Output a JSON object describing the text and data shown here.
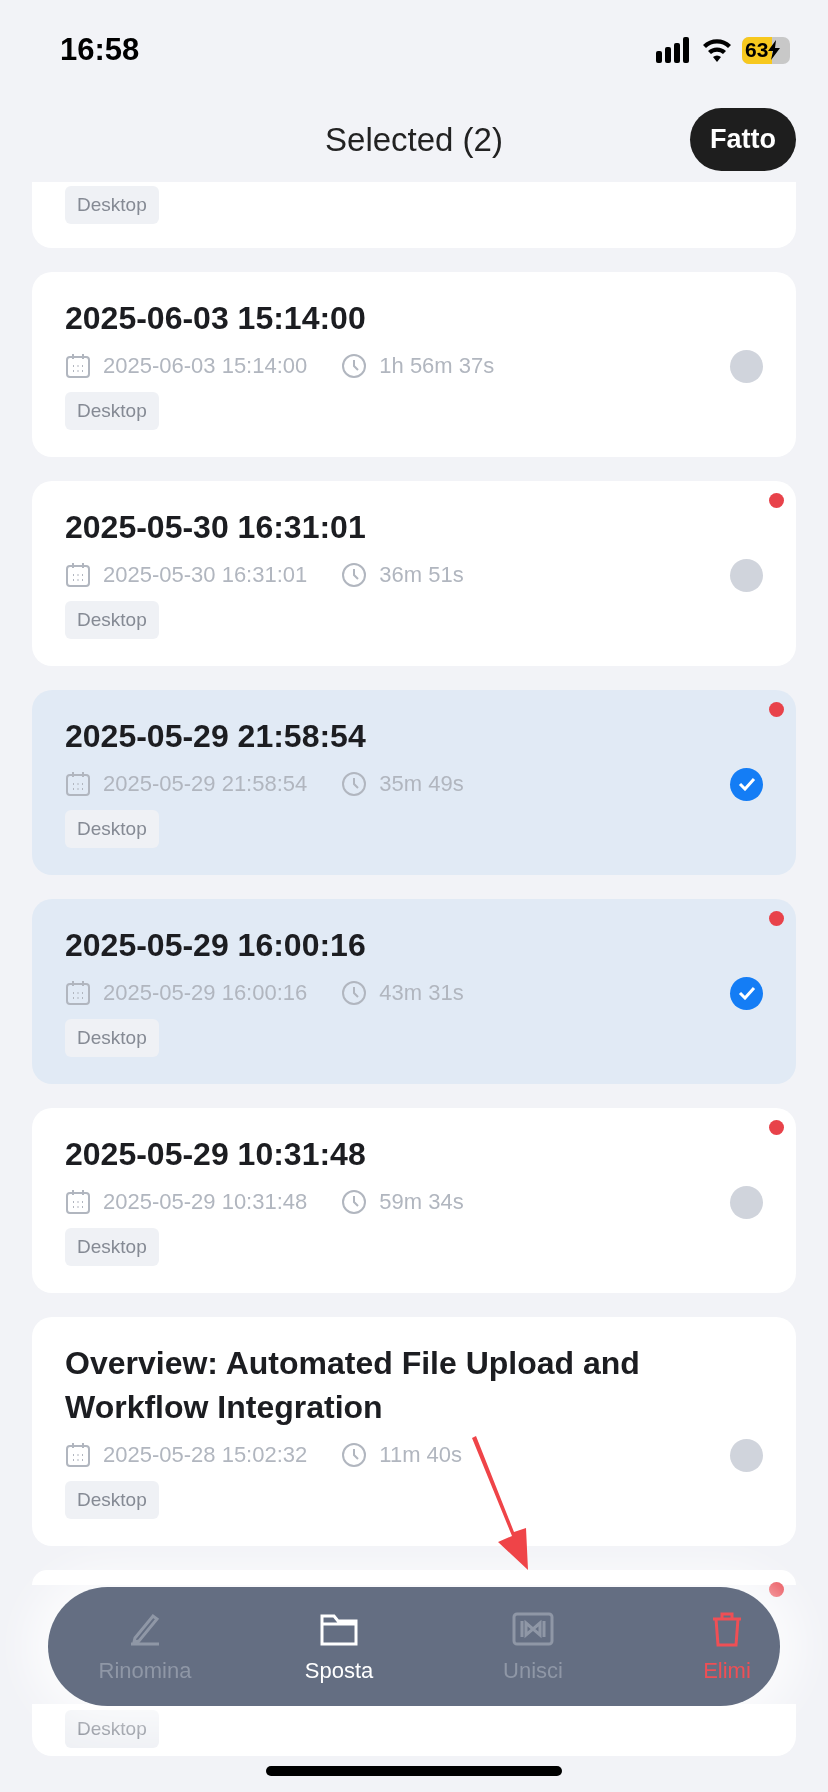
{
  "status_bar": {
    "time": "16:58",
    "battery": "63",
    "charging": true
  },
  "header": {
    "title": "Selected (2)",
    "done_button": "Fatto"
  },
  "recordings": [
    {
      "tag": "Desktop"
    },
    {
      "title": "2025-06-03 15:14:00",
      "date": "2025-06-03 15:14:00",
      "duration": "1h 56m 37s",
      "tag": "Desktop",
      "selected": false,
      "unread": false
    },
    {
      "title": "2025-05-30 16:31:01",
      "date": "2025-05-30 16:31:01",
      "duration": "36m 51s",
      "tag": "Desktop",
      "selected": false,
      "unread": true
    },
    {
      "title": "2025-05-29 21:58:54",
      "date": "2025-05-29 21:58:54",
      "duration": "35m 49s",
      "tag": "Desktop",
      "selected": true,
      "unread": true
    },
    {
      "title": "2025-05-29 16:00:16",
      "date": "2025-05-29 16:00:16",
      "duration": "43m 31s",
      "tag": "Desktop",
      "selected": true,
      "unread": true
    },
    {
      "title": "2025-05-29 10:31:48",
      "date": "2025-05-29 10:31:48",
      "duration": "59m 34s",
      "tag": "Desktop",
      "selected": false,
      "unread": true
    },
    {
      "title": "Overview: Automated File Upload and Workflow Integration",
      "date": "2025-05-28 15:02:32",
      "duration": "11m 40s",
      "tag": "Desktop",
      "selected": false,
      "unread": false
    },
    {
      "tag": "Desktop",
      "unread": true
    }
  ],
  "action_bar": [
    {
      "kind": "rename",
      "label": "Rinomina",
      "disabled": true
    },
    {
      "kind": "move",
      "label": "Sposta",
      "disabled": false
    },
    {
      "kind": "merge",
      "label": "Unisci",
      "disabled": true
    },
    {
      "kind": "delete",
      "label": "Elimi",
      "disabled": false
    }
  ]
}
